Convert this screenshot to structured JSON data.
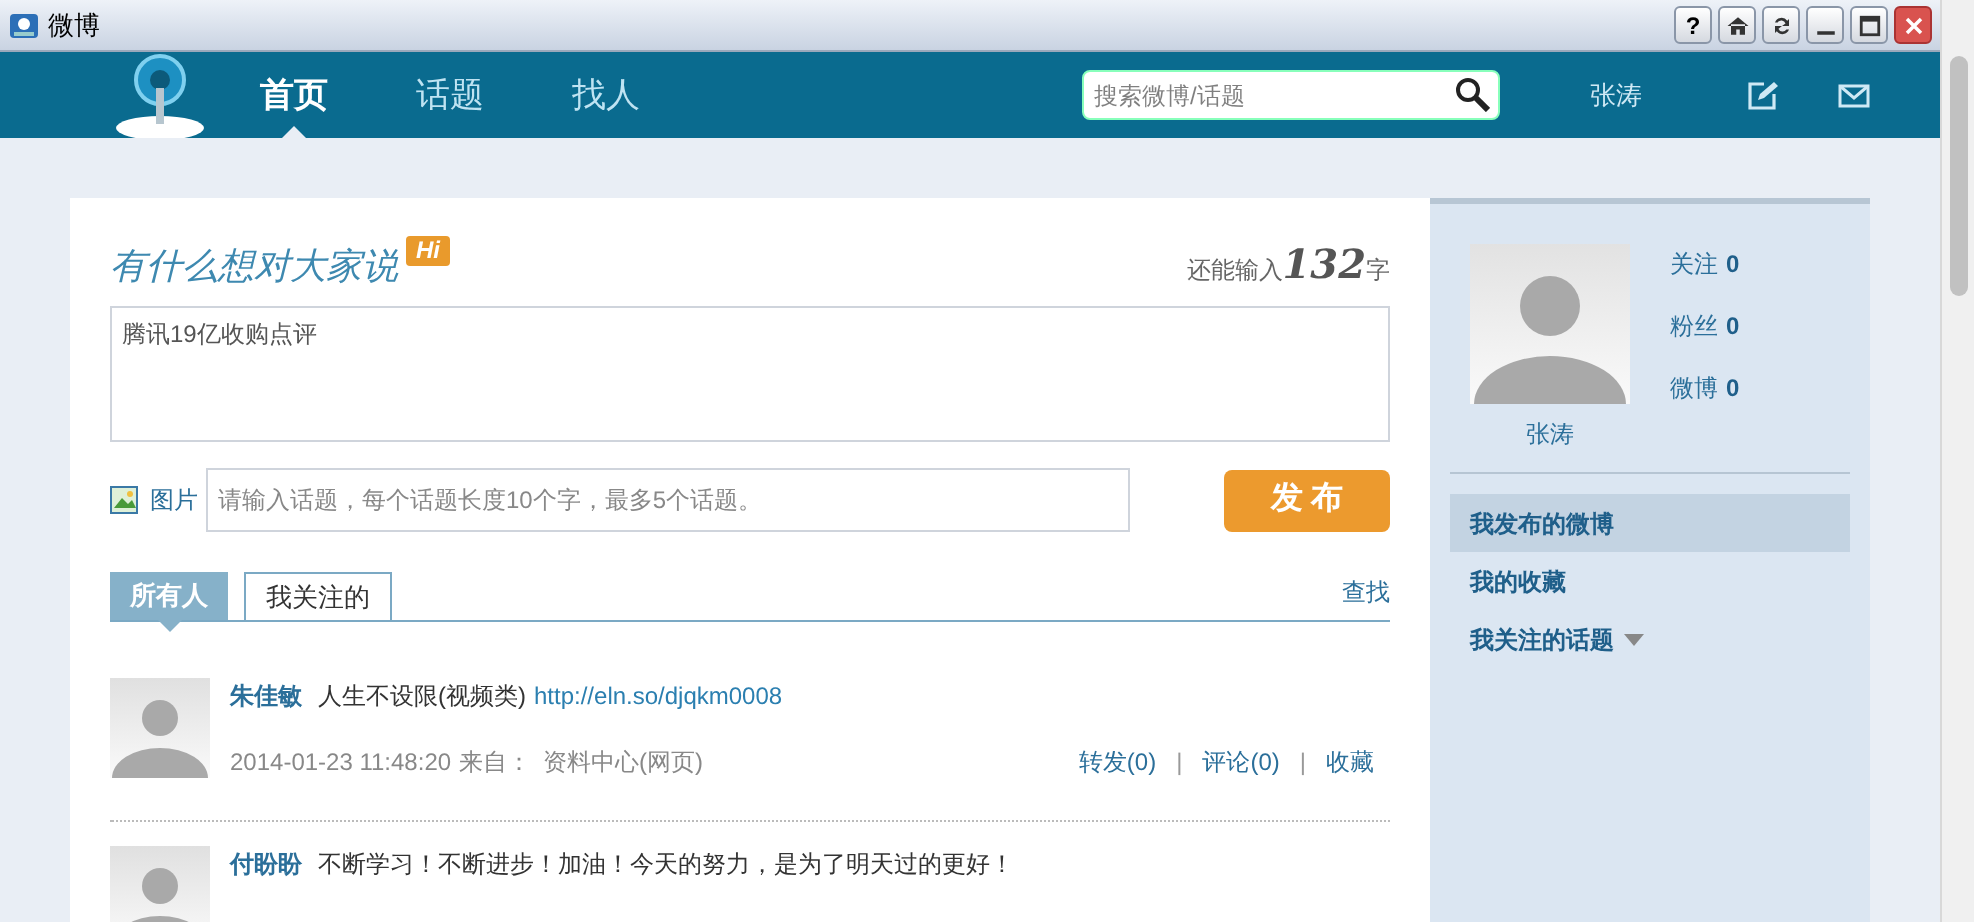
{
  "window": {
    "title": "微博",
    "buttons": [
      {
        "kind": "help",
        "label": "?"
      },
      {
        "kind": "home"
      },
      {
        "kind": "refresh"
      },
      {
        "kind": "minimize"
      },
      {
        "kind": "maximize"
      },
      {
        "kind": "close"
      }
    ]
  },
  "nav": {
    "tabs": [
      {
        "label": "首页",
        "selected": true
      },
      {
        "label": "话题",
        "selected": false
      },
      {
        "label": "找人",
        "selected": false
      }
    ],
    "search": {
      "placeholder": "搜索微博/话题"
    },
    "user": "张涛"
  },
  "composer": {
    "title": "有什么想对大家说",
    "badge": "Hi",
    "counter": {
      "prefix": "还能输入",
      "number": "132",
      "suffix": "字"
    },
    "value": "腾讯19亿收购点评",
    "image_label": "图片",
    "topic_placeholder": "请输入话题，每个话题长度10个字，最多5个话题。",
    "submit": "发 布"
  },
  "feed_tabs": [
    {
      "label": "所有人",
      "selected": true
    },
    {
      "label": "我关注的",
      "selected": false
    }
  ],
  "find_link": "查找",
  "posts": [
    {
      "author": "朱佳敏",
      "text": "人生不设限(视频类)",
      "link": "http://eln.so/djqkm0008",
      "time": "2014-01-23 11:48:20",
      "source_label": "来自：",
      "source": "资料中心(网页)",
      "actions": [
        "转发(0)",
        "评论(0)",
        "收藏"
      ],
      "separator": "|"
    },
    {
      "author": "付盼盼",
      "text": "不断学习！不断进步！加油！今天的努力，是为了明天过的更好！"
    }
  ],
  "profile": {
    "name": "张涛",
    "stats": [
      {
        "label": "关注",
        "value": "0"
      },
      {
        "label": "粉丝",
        "value": "0"
      },
      {
        "label": "微博",
        "value": "0"
      }
    ]
  },
  "side_menu": [
    {
      "label": "我发布的微博",
      "selected": true,
      "dropdown": false
    },
    {
      "label": "我的收藏",
      "selected": false,
      "dropdown": false
    },
    {
      "label": "我关注的话题",
      "selected": false,
      "dropdown": true
    }
  ]
}
